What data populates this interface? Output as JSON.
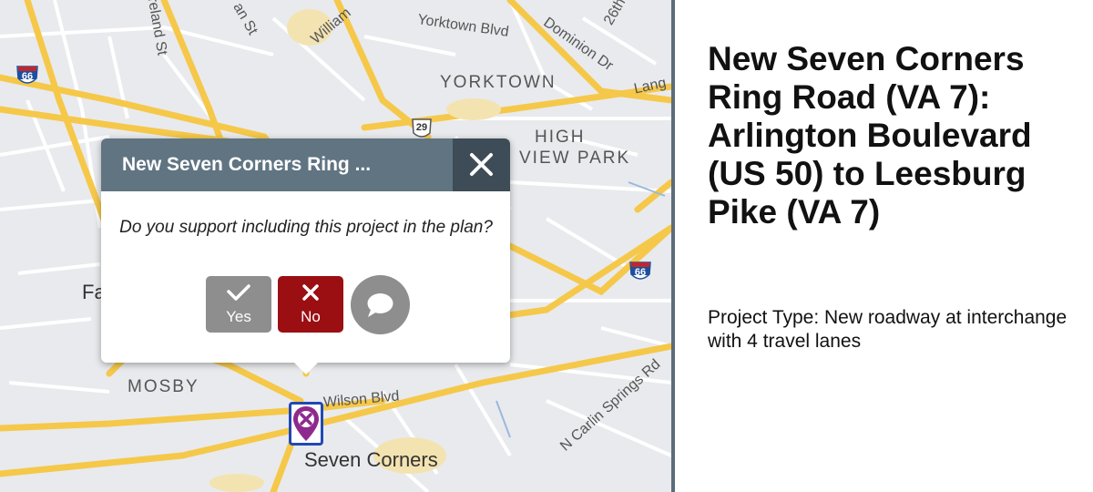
{
  "map": {
    "street_labels": [
      "Yorktown Blvd",
      "Dominion Dr",
      "26th",
      "Lang",
      "Wilson Blvd",
      "N Carlin Springs Rd",
      "reland St",
      "an St",
      "William"
    ],
    "area_labels": [
      "YORKTOWN",
      "HIGH",
      "VIEW PARK",
      "MOSBY"
    ],
    "place_labels": [
      "Fa",
      "Seven Corners"
    ],
    "shields": [
      "66",
      "29",
      "66"
    ]
  },
  "popup": {
    "title": "New Seven Corners Ring ...",
    "question": "Do you support including this project in the plan?",
    "yes_label": "Yes",
    "no_label": "No",
    "icons": {
      "close": "close-icon",
      "yes": "check-icon",
      "no": "x-icon",
      "comment": "comment-icon"
    }
  },
  "marker": {
    "icon": "map-pin-x-icon",
    "color": "#8e2a8e"
  },
  "details": {
    "title": "New Seven Corners Ring Road (VA 7): Arlington Boulevard (US 50) to Leesburg Pike (VA 7)",
    "project_type": "Project Type: New roadway at interchange with 4 travel lanes"
  },
  "colors": {
    "header": "#607482",
    "close_bg": "#3d4c56",
    "no_button": "#9b0e12",
    "yes_button": "#8e8e8e",
    "road": "#f5c84a"
  }
}
